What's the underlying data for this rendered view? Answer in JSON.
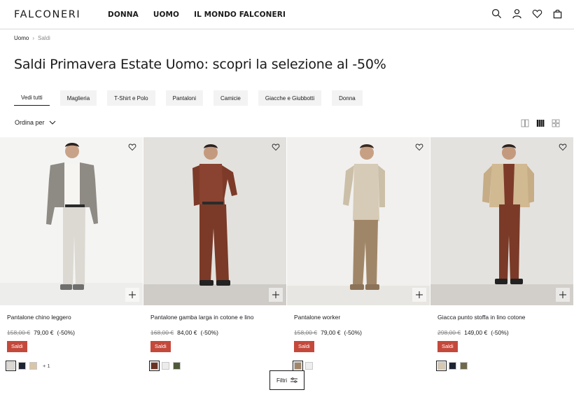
{
  "header": {
    "logo": "FALCONERI",
    "nav": [
      {
        "label": "DONNA"
      },
      {
        "label": "UOMO"
      },
      {
        "label": "IL MONDO FALCONERI"
      }
    ],
    "icons": [
      "search-icon",
      "account-icon",
      "wishlist-icon",
      "bag-icon"
    ]
  },
  "breadcrumb": {
    "items": [
      "Uomo",
      "Saldi"
    ],
    "separator": "›"
  },
  "page_title": "Saldi Primavera Estate Uomo: scopri la selezione al -50%",
  "filters": [
    {
      "label": "Vedi tutti",
      "active": true
    },
    {
      "label": "Maglieria"
    },
    {
      "label": "T-Shirt e Polo"
    },
    {
      "label": "Pantaloni"
    },
    {
      "label": "Camicie"
    },
    {
      "label": "Giacche e Giubbotti"
    },
    {
      "label": "Donna"
    }
  ],
  "sort": {
    "label": "Ordina per"
  },
  "view_toggles": [
    "two-column-view-icon",
    "four-column-view-icon",
    "grid-view-icon"
  ],
  "products": [
    {
      "name": "Pantalone chino leggero",
      "old_price": "158,00 €",
      "new_price": "79,00 €",
      "discount": "(-50%)",
      "badge": "Saldi",
      "swatches": [
        "#dcd9d2",
        "#1f2433",
        "#d9c5a8"
      ],
      "more": "+ 1"
    },
    {
      "name": "Pantalone gamba larga in cotone e lino",
      "old_price": "168,00 €",
      "new_price": "84,00 €",
      "discount": "(-50%)",
      "badge": "Saldi",
      "swatches": [
        "#6b3324",
        "#ececec",
        "#4f5a3a"
      ],
      "more": ""
    },
    {
      "name": "Pantalone worker",
      "old_price": "158,00 €",
      "new_price": "79,00 €",
      "discount": "(-50%)",
      "badge": "Saldi",
      "swatches": [
        "#a08668",
        "#eeeeee"
      ],
      "more": ""
    },
    {
      "name": "Giacca punto stoffa in lino cotone",
      "old_price": "298,00 €",
      "new_price": "149,00 €",
      "discount": "(-50%)",
      "badge": "Saldi",
      "swatches": [
        "#d6c8b1",
        "#1f2433",
        "#6f6a4c"
      ],
      "more": ""
    }
  ],
  "filter_button": {
    "label": "Filtri"
  },
  "colors": {
    "sale_badge": "#c4493b",
    "accent": "#1a1a1a"
  }
}
